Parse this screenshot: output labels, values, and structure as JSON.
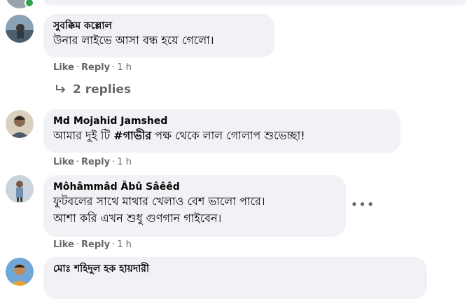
{
  "comments": [
    {
      "author": "সুবক্কিম কল্লোল",
      "lines": [
        "উনার লাইভে আসা বন্ধ হয়ে গেলো।"
      ],
      "like_label": "Like",
      "reply_label": "Reply",
      "time": "1 h",
      "replies_label": "2 replies"
    },
    {
      "author": "Md Mojahid Jamshed",
      "text_before": "আমার দুই টি ",
      "hashtag": "#গাভীর",
      "text_after": " পক্ষ থেকে লাল গোলাপ শুভেচ্ছা!",
      "like_label": "Like",
      "reply_label": "Reply",
      "time": "1 h"
    },
    {
      "author": "Môhâmmâd Âbû Sâêêd",
      "lines": [
        "ফুটবলের সাথে মাথার খেলাও বেশ ভালো পারে।",
        "আশা করি এখন শুধু গুণগান গাইবেন।"
      ],
      "like_label": "Like",
      "reply_label": "Reply",
      "time": "1 h",
      "more_label": "•••"
    },
    {
      "author": "মোঃ শহিদুল হক হায়দারী"
    }
  ],
  "colors": {
    "bubble": "#f0f2f5",
    "meta_text": "#65676b",
    "online": "#31a24c"
  },
  "icons": [
    "reply-arrow-icon",
    "more-options-icon",
    "online-status-icon"
  ]
}
